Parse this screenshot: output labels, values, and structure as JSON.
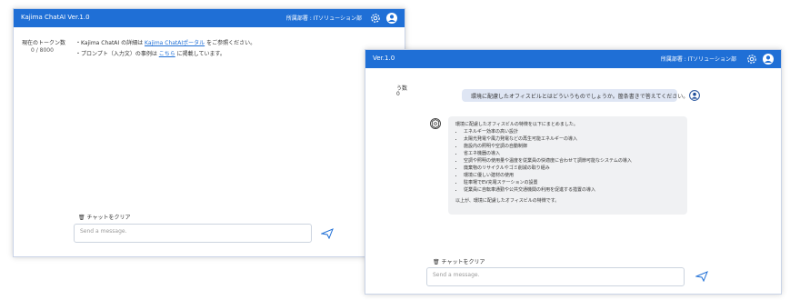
{
  "app": {
    "title": "Kajima ChatAI  Ver.1.0",
    "title_short": "Ver.1.0",
    "department": "所属部署 : ITソリューション部"
  },
  "window_front": {
    "token_label": "現在のトークン数",
    "token_value": "0 / 8000",
    "info_line1_prefix": "・Kajima ChatAI の詳細は ",
    "info_line1_link": "Kajima ChatAIポータル",
    "info_line1_suffix": " をご参照ください。",
    "info_line2_prefix": "・プロンプト（入力文）の事例は ",
    "info_line2_link": "こちら",
    "info_line2_suffix": " に掲載しています。",
    "clear_label": "🗑 チャットをクリア",
    "input_placeholder": "Send a message."
  },
  "window_back": {
    "token_partial_line1": "う数",
    "token_partial_line2": "0",
    "user_message": "環境に配慮したオフィスビルとはどういうものでしょうか。箇条書きで答えてください。",
    "bot_intro": "環境に配慮したオフィスビルの特徴を以下にまとめました。",
    "bot_items": [
      "エネルギー効率の高い設計",
      "太陽光発電や風力発電などの再生可能エネルギーの導入",
      "施設内の照明や空調の自動制御",
      "省エネ機器の導入",
      "空調や照明の使用量や温度を従業員の快適度に合わせて調節可能なシステムの導入",
      "廃棄物のリサイクルやゴミ削減の取り組み",
      "環境に優しい建材の使用",
      "駐車場でEV充電ステーションの設置",
      "従業員に自転車通勤や公共交通機関の利用を促進する措置の導入"
    ],
    "bot_closing": "以上が、環境に配慮したオフィスビルの特徴です。",
    "clear_label": "🗑 チャットをクリア",
    "input_placeholder": "Send a message."
  },
  "icons": {
    "gear": "gear-icon",
    "user": "user-icon",
    "send": "send-icon",
    "bot": "chatgpt-logo-icon",
    "trash": "trash-icon"
  },
  "colors": {
    "header": "#1f6fd6",
    "user_bubble": "#dfe6f4",
    "bot_bubble": "#f0f1f3",
    "link": "#1f6fd6"
  }
}
